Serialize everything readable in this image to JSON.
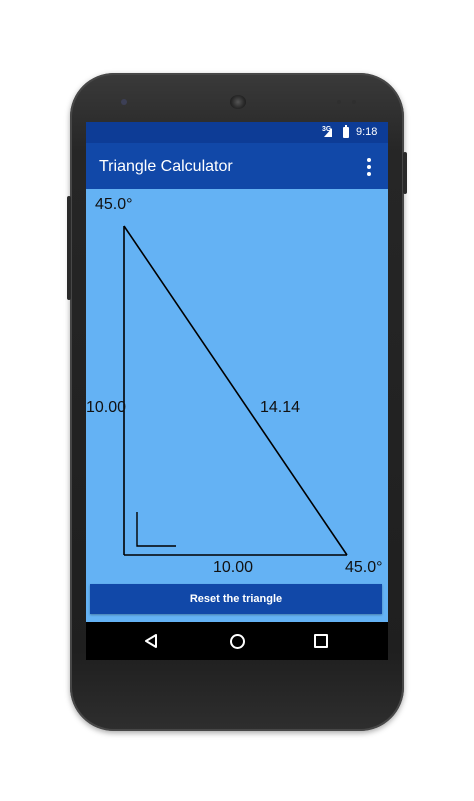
{
  "status_bar": {
    "network": "3G",
    "time": "9:18"
  },
  "app_bar": {
    "title": "Triangle Calculator",
    "overflow_icon": "more-vert-icon"
  },
  "triangle": {
    "top_angle": "45.0°",
    "right_angle": "45.0°",
    "left_side": "10.00",
    "bottom_side": "10.00",
    "hypotenuse": "14.14",
    "fill_color": "#64b2f4",
    "line_color": "#000000"
  },
  "actions": {
    "reset_label": "Reset the triangle"
  },
  "nav_bar": {
    "back_icon": "back-triangle-icon",
    "home_icon": "home-circle-icon",
    "recents_icon": "recents-square-icon"
  },
  "colors": {
    "status_bar": "#0d3c96",
    "app_bar": "#1148a8",
    "accent": "#1148a8",
    "canvas": "#64b2f4"
  }
}
